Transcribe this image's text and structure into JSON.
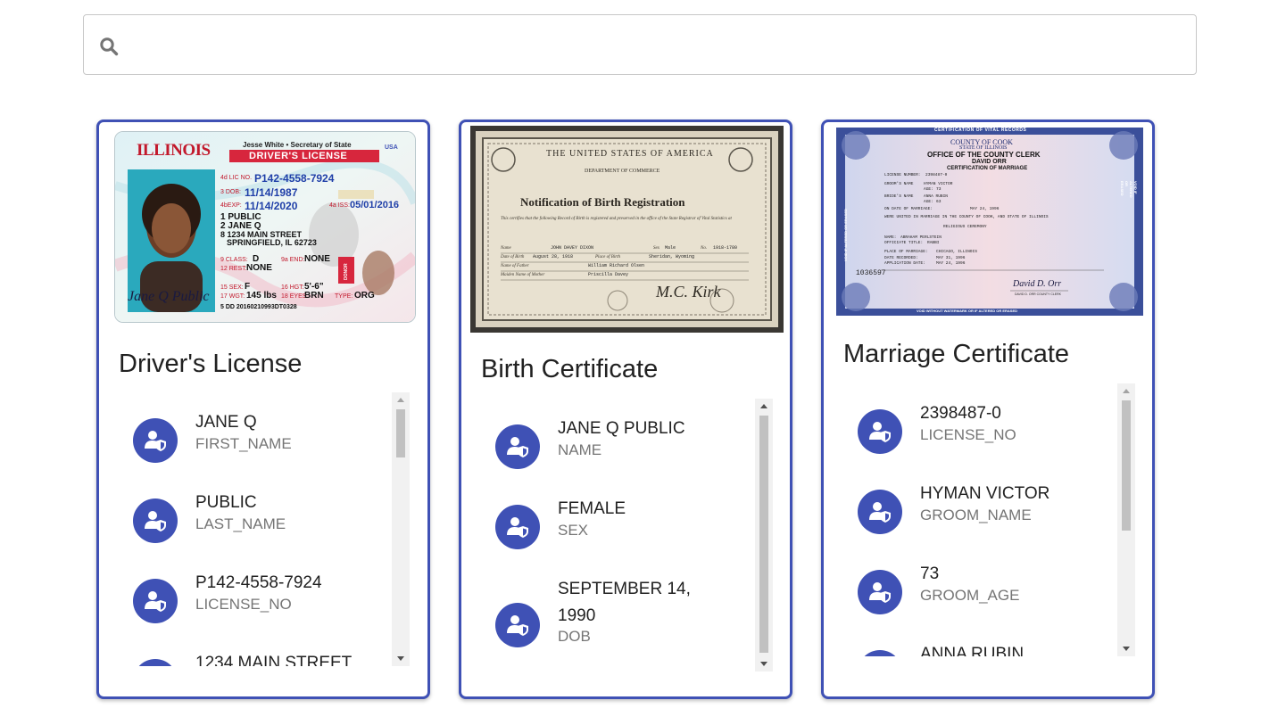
{
  "search": {
    "placeholder": "",
    "value": ""
  },
  "cards": [
    {
      "title": "Driver's License",
      "image": {
        "state": "ILLINOIS",
        "secretary": "Jesse White • Secretary of State",
        "country": "USA",
        "banner": "DRIVER'S LICENSE",
        "lic_no_label": "4d LIC NO.",
        "lic_no": "P142-4558-7924",
        "dob_label": "3 DOB:",
        "dob": "11/14/1987",
        "exp_label": "4bEXP:",
        "exp": "11/14/2020",
        "iss_label": "4a ISS:",
        "iss": "05/01/2016",
        "name1": "1 PUBLIC",
        "name2": "2 JANE Q",
        "addr1": "8 1234 MAIN STREET",
        "addr2": "SPRINGFIELD, IL 62723",
        "class_label": "9 CLASS:",
        "class": "D",
        "end_label": "9a END:",
        "end": "NONE",
        "rest_label": "12 REST:",
        "rest": "NONE",
        "sex_label": "15 SEX:",
        "sex": "F",
        "hgt_label": "16 HGT:",
        "hgt": "5'-6\"",
        "wgt_label": "17 WGT:",
        "wgt": "145 lbs",
        "eyes_label": "18 EYES:",
        "eyes": "BRN",
        "type_label": "TYPE:",
        "type": "ORG",
        "dd": "5 DD 20160210993DT0328",
        "signature": "Jane Q Public",
        "donor": "DONOR"
      },
      "items": [
        {
          "value": "JANE Q",
          "key": "FIRST_NAME"
        },
        {
          "value": "PUBLIC",
          "key": "LAST_NAME"
        },
        {
          "value": "P142-4558-7924",
          "key": "LICENSE_NO"
        },
        {
          "value": "1234 MAIN STREET",
          "key": ""
        }
      ],
      "scroll_fraction": 0.0
    },
    {
      "title": "Birth Certificate",
      "image": {
        "seal_text": "THE UNITED STATES OF AMERICA",
        "dept": "DEPARTMENT OF COMMERCE",
        "heading": "Notification of Birth Registration",
        "body": "This certifies that the following Record of Birth is registered and preserved in the office of the State Registrar of Vital Statistics at",
        "name_label": "Name",
        "name": "JOHN DAVEY DIXON",
        "sex_label": "Sex",
        "sex": "Male",
        "no_label": "No.",
        "no": "1918-1780",
        "birth_label": "Date of Birth",
        "birth_date": "August 28, 1918",
        "place_label": "Place of Birth",
        "place": "Sheridan, Wyoming",
        "father_label": "Name of Father",
        "father": "William Richard Olsen",
        "mother_label": "Maiden Name of Mother",
        "mother": "Priscilla Davey",
        "signature": "M.C. Kirk"
      },
      "items": [
        {
          "value": "JANE Q PUBLIC",
          "key": "NAME"
        },
        {
          "value": "FEMALE",
          "key": "SEX"
        },
        {
          "value": "SEPTEMBER 14, 1990",
          "key": "DOB"
        }
      ],
      "scroll_fraction": 0.0
    },
    {
      "title": "Marriage Certificate",
      "image": {
        "top_banner": "CERTIFICATION OF VITAL RECORDS",
        "county": "COUNTY OF COOK",
        "state": "STATE OF ILLINOIS",
        "office": "OFFICE OF THE COUNTY CLERK",
        "clerk": "DAVID ORR",
        "cert_type": "CERTIFICATION OF MARRIAGE",
        "license_label": "LICENSE NUMBER:",
        "license": "2398487-0",
        "groom_label": "GROOM'S NAME",
        "groom": "HYMAN VICTOR",
        "groom_age_label": "AGE:",
        "groom_age": "73",
        "bride_label": "BRIDE'S NAME",
        "bride": "ANNA RUBIN",
        "bride_age_label": "AGE:",
        "bride_age": "63",
        "date_label": "ON DATE OF MARRIAGE:",
        "date": "MAY 24, 1996",
        "united_text": "WERE UNITED IN MARRIAGE IN THE COUNTY OF COOK, AND STATE OF ILLINOIS",
        "ceremony": "RELIGIOUS CEREMONY",
        "officiant_label": "NAME:",
        "officiant": "ABRAHAM PERLSTEIN",
        "title_label": "OFFICIATE TITLE:",
        "title": "RABBI",
        "place_label": "PLACE OF MARRIAGE:",
        "place": "CHICAGO, ILLINOIS",
        "recorded_label": "DATE RECORDED:",
        "recorded": "MAY 31, 1996",
        "application_label": "APPLICATION DATE:",
        "application": "MAY 24, 1996",
        "serial": "1036597",
        "side_text": "VOID IF ALTERED OR ERASED",
        "bottom_banner": "VOID WITHOUT WATERMARK OR IF ALTERED OR ERASED",
        "signature": "David D. Orr",
        "sig_caption": "DAVID D. ORR COUNTY CLERK"
      },
      "items": [
        {
          "value": "2398487-0",
          "key": "LICENSE_NO"
        },
        {
          "value": "HYMAN VICTOR",
          "key": "GROOM_NAME"
        },
        {
          "value": "73",
          "key": "GROOM_AGE"
        },
        {
          "value": "ANNA RUBIN",
          "key": ""
        }
      ],
      "scroll_fraction": 0.0
    }
  ],
  "icons": {
    "search": "search-icon",
    "item_avatar": "user-shield-icon",
    "scroll_up": "triangle-up-icon",
    "scroll_down": "triangle-down-icon"
  },
  "colors": {
    "accent": "#3f51b5",
    "key_text": "#757575",
    "scroll_track": "#f1f1f1",
    "scroll_thumb": "#c1c1c1"
  }
}
